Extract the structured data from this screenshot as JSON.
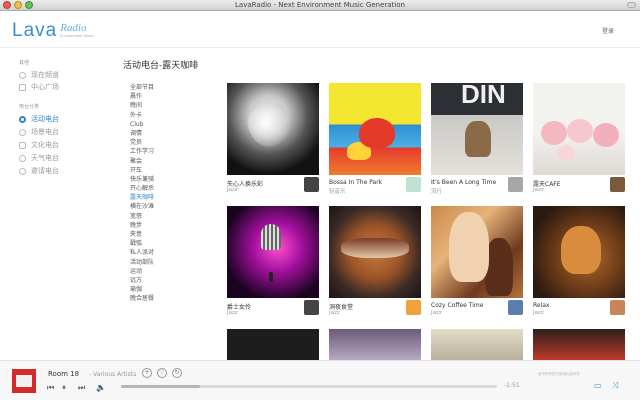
{
  "window": {
    "title": "LavaRadio - Next Environment Music Generation"
  },
  "header": {
    "logo_main": "Lava",
    "logo_sub": "Radio",
    "logo_tagline": "Environment Music",
    "login": "登录"
  },
  "sidebar": {
    "group1": "其他",
    "group1_items": [
      {
        "label": "现在频道",
        "icon": "circle-icon"
      },
      {
        "label": "中心广场",
        "icon": "square-icon"
      }
    ],
    "group2": "电台分类",
    "group2_items": [
      {
        "label": "活动电台",
        "icon": "radio-icon",
        "active": true
      },
      {
        "label": "场景电台",
        "icon": "circle-icon"
      },
      {
        "label": "文化电台",
        "icon": "bubble-icon"
      },
      {
        "label": "天气电台",
        "icon": "circle-icon"
      },
      {
        "label": "邀请电台",
        "icon": "circle-icon"
      }
    ]
  },
  "main": {
    "title": "活动电台-露天咖啡",
    "categories": [
      "全部节目",
      "晨作",
      "晚间",
      "外卡",
      "Club",
      "调情",
      "党员",
      "工作学习",
      "聚会",
      "开车",
      "快乐兼骑",
      "开心解杀",
      "露天咖啡",
      "横在沙滩",
      "宽怒",
      "晚步",
      "夹意",
      "戳弧",
      "私人派对",
      "活动部队",
      "运动",
      "远方",
      "瑜伽",
      "晚合居餐"
    ],
    "active_category": 12,
    "cards": [
      {
        "name": "失心人换乐彩",
        "genre": "Jazz",
        "thumb": "t-heart",
        "avatar": "av-dark"
      },
      {
        "name": "Bossa In The Park",
        "genre": "轻音乐",
        "thumb": "t-park",
        "avatar": "av-mint"
      },
      {
        "name": "It's Been A Long Time",
        "genre": "流行",
        "thumb": "t-dog",
        "avatar": "av-gray"
      },
      {
        "name": "露天CAFE",
        "genre": "Jazz",
        "thumb": "t-roses",
        "avatar": "av-brown"
      },
      {
        "name": "爵士女伶",
        "genre": "Jazz",
        "thumb": "t-mic",
        "avatar": "av-dark"
      },
      {
        "name": "洞夜食堂",
        "genre": "Jazz",
        "thumb": "t-sand",
        "avatar": "av-orange"
      },
      {
        "name": "Cozy Coffee Time",
        "genre": "Jazz",
        "thumb": "t-coffee",
        "avatar": "av-blue"
      },
      {
        "name": "Relax",
        "genre": "Jazz",
        "thumb": "t-cat",
        "avatar": "av-coffee"
      },
      {
        "name": "",
        "genre": "",
        "thumb": "t-row3a",
        "avatar": ""
      },
      {
        "name": "",
        "genre": "",
        "thumb": "t-row3b",
        "avatar": ""
      },
      {
        "name": "",
        "genre": "",
        "thumb": "t-row3c",
        "avatar": ""
      },
      {
        "name": "",
        "genre": "",
        "thumb": "t-row3d",
        "avatar": ""
      }
    ]
  },
  "player": {
    "track": "Room 18",
    "separator": "-",
    "artist": "Various Artists",
    "time": "-1:51",
    "progress_fraction": 0.21,
    "copyright": "音乐所有权归原版权者所有",
    "accent": "#2f86c9"
  }
}
